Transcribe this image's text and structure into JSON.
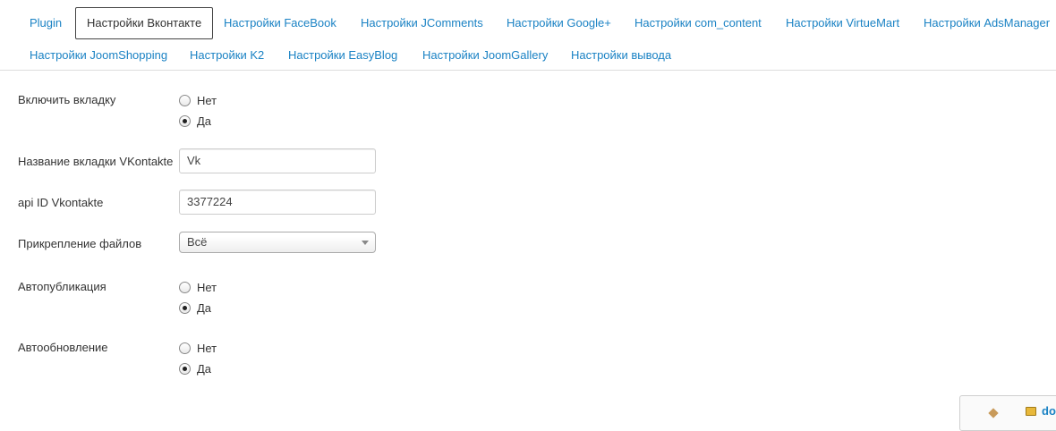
{
  "tabs": {
    "row1": [
      {
        "label": "Plugin",
        "active": false
      },
      {
        "label": "Настройки Вконтакте",
        "active": true
      },
      {
        "label": "Настройки FaceBook",
        "active": false
      },
      {
        "label": "Настройки JComments",
        "active": false
      },
      {
        "label": "Настройки Google+",
        "active": false
      },
      {
        "label": "Настройки com_content",
        "active": false
      },
      {
        "label": "Настройки VirtueMart",
        "active": false
      },
      {
        "label": "Настройки AdsManager",
        "active": false
      }
    ],
    "row2": [
      {
        "label": "Настройки JoomShopping",
        "active": false
      },
      {
        "label": "Настройки K2",
        "active": false
      },
      {
        "label": "Настройки EasyBlog",
        "active": false
      },
      {
        "label": "Настройки JoomGallery",
        "active": false
      },
      {
        "label": "Настройки вывода",
        "active": false
      }
    ]
  },
  "form": {
    "enable_tab": {
      "label": "Включить вкладку",
      "options": [
        "Нет",
        "Да"
      ],
      "selected": "Да"
    },
    "tab_name": {
      "label": "Название вкладки VKontakte",
      "value": "Vk"
    },
    "api_id": {
      "label": "api ID Vkontakte",
      "value": "3377224"
    },
    "attachments": {
      "label": "Прикрепление файлов",
      "value": "Всё"
    },
    "autopublish": {
      "label": "Автопубликация",
      "options": [
        "Нет",
        "Да"
      ],
      "selected": "Да"
    },
    "autoupdate": {
      "label": "Автообновление",
      "options": [
        "Нет",
        "Да"
      ],
      "selected": "Да"
    }
  },
  "corner_widget": {
    "text": "do",
    "icon": "folder-icon"
  },
  "colors": {
    "link": "#1a82c4",
    "text": "#333333",
    "border": "#dddddd"
  }
}
